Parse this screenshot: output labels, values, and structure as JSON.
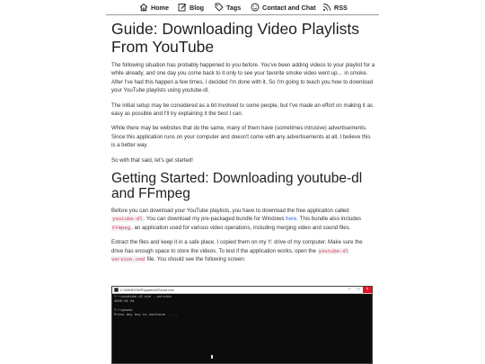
{
  "nav": {
    "items": [
      {
        "label": "Home",
        "icon": "home-icon"
      },
      {
        "label": "Blog",
        "icon": "pencil-icon"
      },
      {
        "label": "Tags",
        "icon": "tag-icon"
      },
      {
        "label": "Contact and Chat",
        "icon": "smiley-icon"
      },
      {
        "label": "RSS",
        "icon": "rss-icon"
      }
    ]
  },
  "article": {
    "title": "Guide: Downloading Video Playlists From YouTube",
    "p1": "The following situation has probably happened to you before. You've been adding videos to your playlist for a while already, and one day you come back to it only to see your favorite smoke video went up… in smoke. After I've had this happen a few times, I decided I'm done with it. So I'm going to teach you how to download your YouTube playlists using youtube-dl.",
    "p2": "The initial setup may be considered as a bit involved to some people, but I've made an effort on making it as easy as possible and I'll try explaining it the best I can.",
    "p3": "While there may be websites that do the same, many of them have (sometimes intrusive) advertisements. Since this application runs on your computer and doesn't come with any advertisements at all, I believe this is a better way.",
    "p4": "So with that said, let's get started!",
    "h2": "Getting Started: Downloading youtube-dl and FFmpeg",
    "p5": {
      "a": "Before you can download your YouTube playlists, you have to download the free application called ",
      "code1": "youtube-dl",
      "b": ". You can download my pre-packaged bundle for Windows ",
      "link": "here",
      "c": ". This bundle also includes ",
      "code2": "FFmpeg",
      "d": ", an application used for various video operations, including merging video and sound files."
    },
    "p6": {
      "a": "Extract the files and keep it in a safe place. I copied them on my Y: drive of my computer. Make sure the drive has enough space to store the videos. To test if the application works, open the ",
      "code": "youtube-dl version.cmd",
      "b": " file. You should see the following screen:"
    }
  },
  "console": {
    "title": "C:\\WINDOWS\\system32\\cmd.exe",
    "lines": "Y:\\>youtube-dl.exe --version\n2020.01.01\n\nY:\\>pause\nPress any key to continue . . ."
  }
}
